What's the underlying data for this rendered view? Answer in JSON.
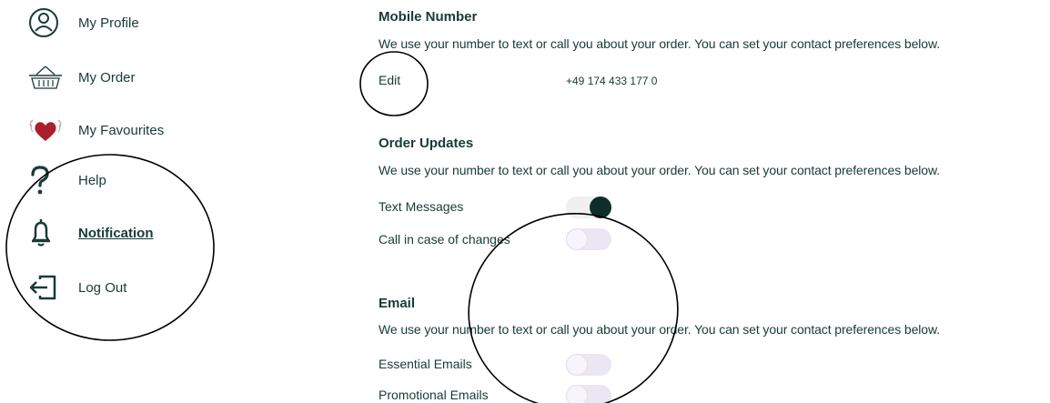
{
  "sidebar": {
    "items": [
      {
        "label": "My Profile",
        "icon": "profile-icon",
        "active": false
      },
      {
        "label": "My Order",
        "icon": "basket-icon",
        "active": false
      },
      {
        "label": "My Favourites",
        "icon": "heart-icon",
        "active": false
      },
      {
        "label": "Help",
        "icon": "question-icon",
        "active": false
      },
      {
        "label": "Notification",
        "icon": "bell-icon",
        "active": true
      },
      {
        "label": "Log Out",
        "icon": "logout-icon",
        "active": false
      }
    ]
  },
  "mobile": {
    "title": "Mobile Number",
    "description": "We use your number to text or call you about your order. You can set your contact preferences below.",
    "edit_label": "Edit",
    "phone": "+49 174 433 177 0"
  },
  "order_updates": {
    "title": "Order Updates",
    "description": "We use your number to text or call you about your order. You can set your contact preferences below.",
    "options": [
      {
        "label": "Text Messages",
        "enabled": true
      },
      {
        "label": "Call in case of changes",
        "enabled": false
      }
    ]
  },
  "email": {
    "title": "Email",
    "description": "We use your number to text or call you about your order. You can set your contact preferences below.",
    "options": [
      {
        "label": "Essential Emails",
        "enabled": false
      },
      {
        "label": "Promotional Emails",
        "enabled": false
      }
    ]
  },
  "colors": {
    "text": "#173b36",
    "toggle_on_knob": "#0f2e2b",
    "toggle_off_track": "#ebe6f4",
    "heart": "#a8202e"
  }
}
